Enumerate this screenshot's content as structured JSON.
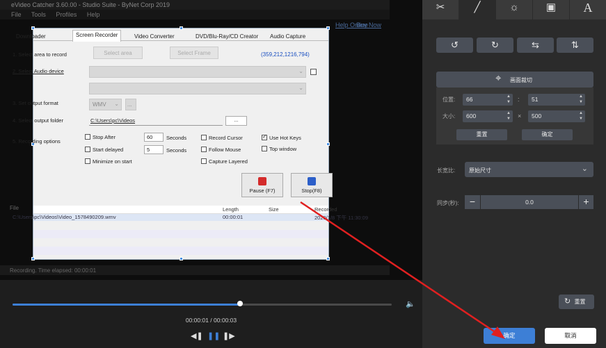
{
  "background_app": {
    "title": "eVideo Catcher 3.60.00 - Studio Suite - ByNet Corp 2019",
    "menu": [
      "File",
      "Tools",
      "Profiles",
      "Help"
    ],
    "links": [
      "Help Online",
      "Buy Now"
    ],
    "status": "Recording. Time elapsed: 00:00:01",
    "file_list_header": "File"
  },
  "capture_window": {
    "tabs": [
      "Downloader",
      "Screen Recorder",
      "Video Converter",
      "DVD/Blu-Ray/CD Creator",
      "Audio Capture"
    ],
    "active_tab": "Screen Recorder",
    "steps": {
      "select_area": "1. Select area to record",
      "audio_device": "2. Select Audio device",
      "output_format": "3. Set output format",
      "output_folder": "4. Select output folder",
      "recording_options": "5. Recording options"
    },
    "select_area_button": "Select area",
    "select_frame_button": "Select Frame",
    "coords": "(359,212,1216,794)",
    "format_value": "WMV",
    "format_more_button": "...",
    "output_folder_value": "C:\\Users\\pc\\Videos",
    "browse_button": "...",
    "options": {
      "stop_after": "Stop After",
      "stop_after_value": "60",
      "seconds_1": "Seconds",
      "start_delayed": "Start delayed",
      "start_delayed_value": "5",
      "seconds_2": "Seconds",
      "minimize_on_start": "Minimize on start",
      "record_cursor": "Record Cursor",
      "follow_mouse": "Follow Mouse",
      "capture_layered": "Capture Layered",
      "use_hot_keys": "Use Hot Keys",
      "top_window": "Top window"
    },
    "pause_button": "Pause (F7)",
    "stop_button": "Stop(F8)",
    "file_list": {
      "columns": [
        "File",
        "Length",
        "Size",
        "Recorded"
      ],
      "row": {
        "file": "C:\\Users\\pc\\Videos\\Video_1578490209.wmv",
        "length": "00:00:01",
        "size": "",
        "recorded": "2020/1/8 下午 11:30:09"
      }
    }
  },
  "player": {
    "progress_fraction": 0.6,
    "timecode": "00:00:01 / 00:00:03",
    "volume_icon": "speaker-icon"
  },
  "panel": {
    "tab_icons": [
      "scissors-icon",
      "wand-icon",
      "brightness-icon",
      "watermark-icon",
      "text-icon"
    ],
    "active_tab": 1,
    "rotate_buttons": [
      "rotate-left-icon",
      "rotate-right-icon",
      "flip-horizontal-icon",
      "flip-vertical-icon"
    ],
    "crop_title": "画面裁切",
    "position_label": "位置:",
    "pos_x": "66",
    "pos_y": "51",
    "size_label": "大小:",
    "width": "600",
    "height": "500",
    "reset_crop_button": "重置",
    "confirm_crop_button": "确定",
    "ratio_label": "长宽比:",
    "ratio_value": "原始尺寸",
    "sync_label": "同步(秒):",
    "sync_value": "0.0",
    "reset_button": "重置",
    "ok_button": "确定",
    "cancel_button": "取消",
    "accent_color": "#3d7fd6",
    "annotation_color": "#e02020"
  }
}
